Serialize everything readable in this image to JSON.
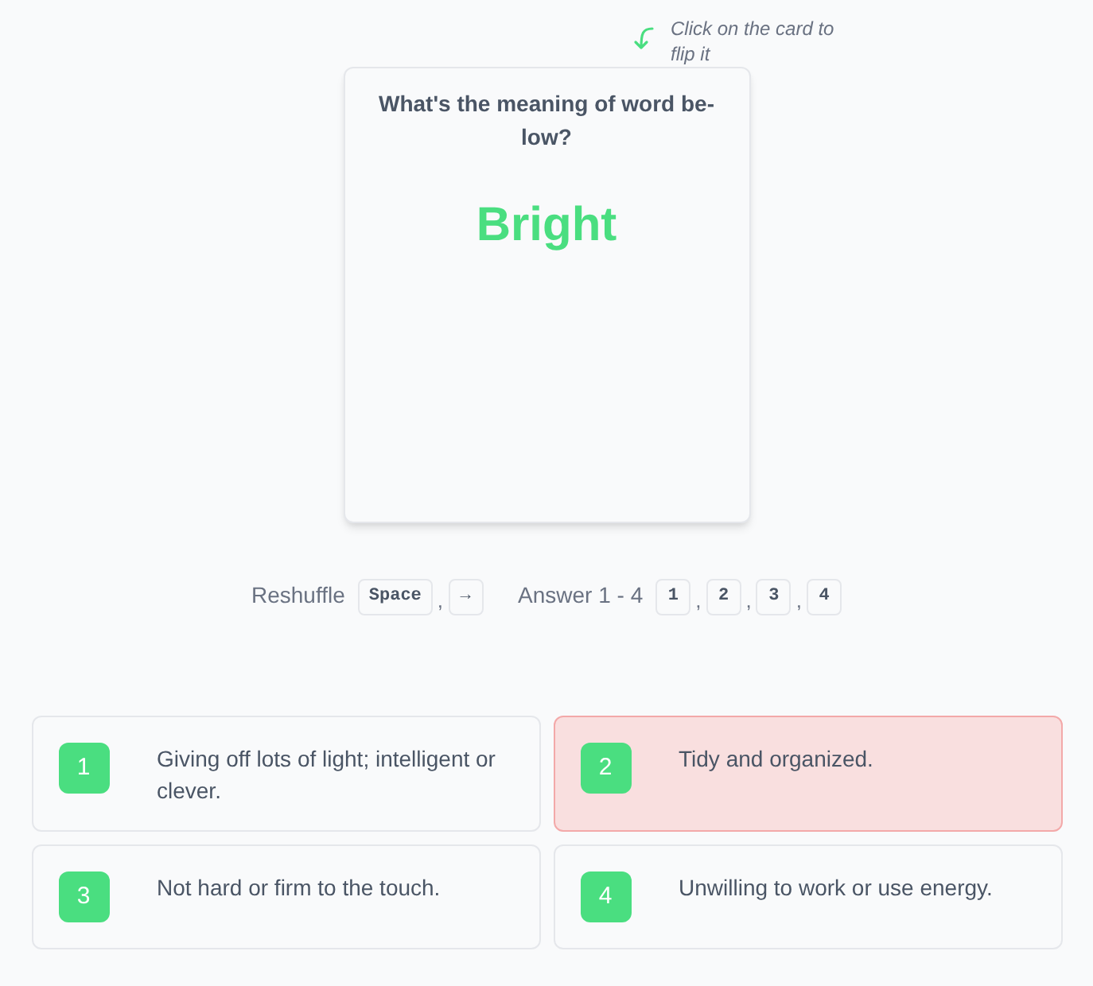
{
  "hint": "Click on the card to flip it",
  "card": {
    "question": "What's the meaning of word be-low?",
    "word": "Bright"
  },
  "shortcuts": {
    "reshuffle_label": "Reshuffle",
    "reshuffle_keys": [
      "Space",
      "→"
    ],
    "answer_label": "Answer 1 - 4",
    "answer_keys": [
      "1",
      "2",
      "3",
      "4"
    ],
    "separator": ","
  },
  "options": [
    {
      "number": "1",
      "text": "Giving off lots of light; intelligent or clever.",
      "wrong": false
    },
    {
      "number": "2",
      "text": "Tidy and organized.",
      "wrong": true
    },
    {
      "number": "3",
      "text": "Not hard or firm to the touch.",
      "wrong": false
    },
    {
      "number": "4",
      "text": "Unwilling to work or use energy.",
      "wrong": false
    }
  ]
}
